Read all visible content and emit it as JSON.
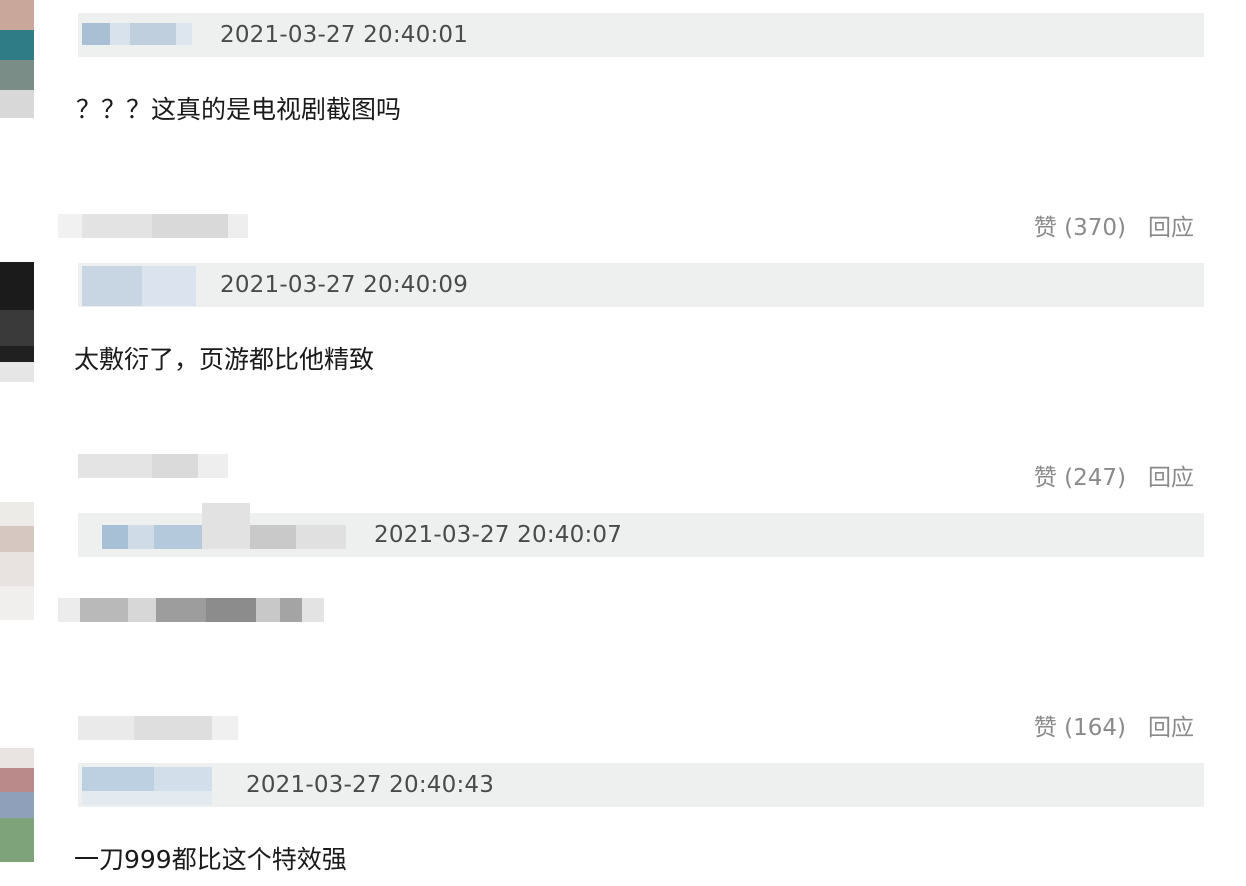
{
  "comments": [
    {
      "timestamp": "2021-03-27 20:40:01",
      "text": "？？？这真的是电视剧截图吗"
    },
    {
      "like_label": "赞 (370)",
      "reply_label": "回应",
      "timestamp": "2021-03-27 20:40:09",
      "text": "太敷衍了，页游都比他精致"
    },
    {
      "like_label": "赞 (247)",
      "reply_label": "回应",
      "timestamp": "2021-03-27 20:40:07",
      "text": ""
    },
    {
      "like_label": "赞 (164)",
      "reply_label": "回应",
      "timestamp": "2021-03-27 20:40:43",
      "text": "一刀999都比这个特效强"
    }
  ],
  "colors": {
    "meta_bar": "#eef0f0",
    "timestamp": "#4a4a4a",
    "action": "#8a8a8a",
    "text": "#1a1a1a"
  },
  "icons": {
    "avatar": "pixelated-avatar-icon"
  }
}
